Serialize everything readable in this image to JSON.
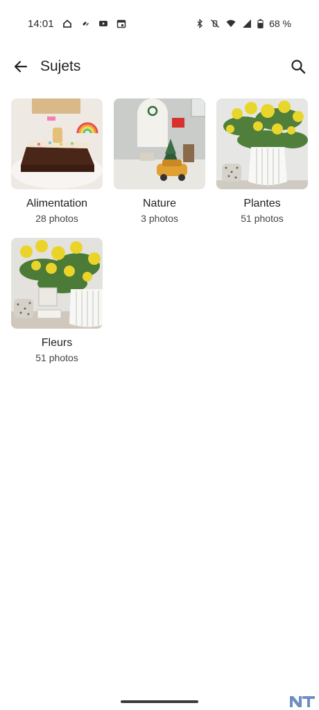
{
  "status_bar": {
    "time": "14:01",
    "battery": "68 %",
    "left_icons": [
      "home-icon",
      "vpn-key-icon",
      "youtube-icon",
      "calendar-icon"
    ],
    "right_icons": [
      "bluetooth-icon",
      "vibrate-off-icon",
      "wifi-icon",
      "signal-icon",
      "battery-icon"
    ]
  },
  "header": {
    "title": "Sujets",
    "back_icon": "arrow-left-icon",
    "search_icon": "search-icon"
  },
  "albums": [
    {
      "name": "Alimentation",
      "count": "28 photos"
    },
    {
      "name": "Nature",
      "count": "3 photos"
    },
    {
      "name": "Plantes",
      "count": "51 photos"
    },
    {
      "name": "Fleurs",
      "count": "51 photos"
    }
  ],
  "colors": {
    "background": "#ffffff",
    "text_primary": "#1f1f1f",
    "text_secondary": "#444444"
  }
}
